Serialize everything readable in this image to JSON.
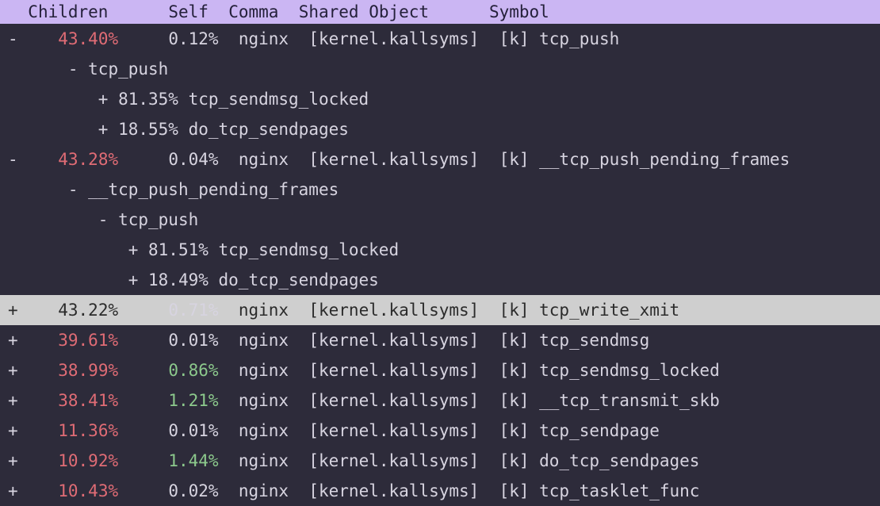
{
  "columns": {
    "children": "Children",
    "self": "Self",
    "command": "Comma",
    "shared_object": "Shared Object",
    "symbol": "Symbol"
  },
  "rows": [
    {
      "expander": "-",
      "children_pct": "43.40%",
      "self_pct": "0.12%",
      "self_green": false,
      "command": "nginx",
      "shared_object": "[kernel.kallsyms]",
      "flag": "[k]",
      "symbol": "tcp_push",
      "selected": false,
      "sublines": [
        {
          "indent": 1,
          "expander": "-",
          "text": "tcp_push"
        },
        {
          "indent": 2,
          "expander": "+",
          "pct": "81.35%",
          "text": "tcp_sendmsg_locked"
        },
        {
          "indent": 2,
          "expander": "+",
          "pct": "18.55%",
          "text": "do_tcp_sendpages"
        }
      ]
    },
    {
      "expander": "-",
      "children_pct": "43.28%",
      "self_pct": "0.04%",
      "self_green": false,
      "command": "nginx",
      "shared_object": "[kernel.kallsyms]",
      "flag": "[k]",
      "symbol": "__tcp_push_pending_frames",
      "selected": false,
      "sublines": [
        {
          "indent": 1,
          "expander": "-",
          "text": "__tcp_push_pending_frames"
        },
        {
          "indent": 2,
          "expander": "-",
          "text": "tcp_push"
        },
        {
          "indent": 3,
          "expander": "+",
          "pct": "81.51%",
          "text": "tcp_sendmsg_locked"
        },
        {
          "indent": 3,
          "expander": "+",
          "pct": "18.49%",
          "text": "do_tcp_sendpages"
        }
      ]
    },
    {
      "expander": "+",
      "children_pct": "43.22%",
      "self_pct": "0.71%",
      "self_green": false,
      "command": "nginx",
      "shared_object": "[kernel.kallsyms]",
      "flag": "[k]",
      "symbol": "tcp_write_xmit",
      "selected": true,
      "sublines": []
    },
    {
      "expander": "+",
      "children_pct": "39.61%",
      "self_pct": "0.01%",
      "self_green": false,
      "command": "nginx",
      "shared_object": "[kernel.kallsyms]",
      "flag": "[k]",
      "symbol": "tcp_sendmsg",
      "selected": false,
      "sublines": []
    },
    {
      "expander": "+",
      "children_pct": "38.99%",
      "self_pct": "0.86%",
      "self_green": true,
      "command": "nginx",
      "shared_object": "[kernel.kallsyms]",
      "flag": "[k]",
      "symbol": "tcp_sendmsg_locked",
      "selected": false,
      "sublines": []
    },
    {
      "expander": "+",
      "children_pct": "38.41%",
      "self_pct": "1.21%",
      "self_green": true,
      "command": "nginx",
      "shared_object": "[kernel.kallsyms]",
      "flag": "[k]",
      "symbol": "__tcp_transmit_skb",
      "selected": false,
      "sublines": []
    },
    {
      "expander": "+",
      "children_pct": "11.36%",
      "self_pct": "0.01%",
      "self_green": false,
      "command": "nginx",
      "shared_object": "[kernel.kallsyms]",
      "flag": "[k]",
      "symbol": "tcp_sendpage",
      "selected": false,
      "sublines": []
    },
    {
      "expander": "+",
      "children_pct": "10.92%",
      "self_pct": "1.44%",
      "self_green": true,
      "command": "nginx",
      "shared_object": "[kernel.kallsyms]",
      "flag": "[k]",
      "symbol": "do_tcp_sendpages",
      "selected": false,
      "sublines": []
    },
    {
      "expander": "+",
      "children_pct": "10.43%",
      "self_pct": "0.02%",
      "self_green": false,
      "command": "nginx",
      "shared_object": "[kernel.kallsyms]",
      "flag": "[k]",
      "symbol": "tcp_tasklet_func",
      "selected": false,
      "sublines": []
    }
  ]
}
